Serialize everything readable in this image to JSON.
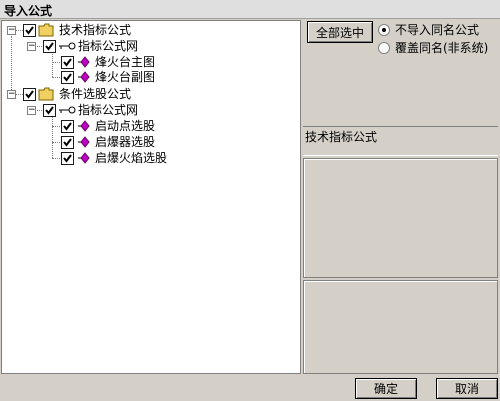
{
  "window": {
    "title": "导入公式"
  },
  "tree": {
    "groups": [
      {
        "label": "技术指标公式",
        "expanded": true,
        "checked": true,
        "icon": "folder-icon",
        "children": [
          {
            "label": "指标公式网",
            "expanded": true,
            "checked": true,
            "icon": "key-icon",
            "items": [
              {
                "label": "烽火台主图",
                "checked": true,
                "icon": "diamond-icon"
              },
              {
                "label": "烽火台副图",
                "checked": true,
                "icon": "diamond-icon"
              }
            ]
          }
        ]
      },
      {
        "label": "条件选股公式",
        "expanded": true,
        "checked": true,
        "icon": "folder-icon",
        "children": [
          {
            "label": "指标公式网",
            "expanded": true,
            "checked": true,
            "icon": "key-icon",
            "items": [
              {
                "label": "启动点选股",
                "checked": true,
                "icon": "diamond-icon"
              },
              {
                "label": "启爆器选股",
                "checked": true,
                "icon": "diamond-icon"
              },
              {
                "label": "启爆火焰选股",
                "checked": true,
                "icon": "diamond-icon"
              }
            ]
          }
        ]
      }
    ]
  },
  "options": {
    "select_all_label": "全部选中",
    "radio_no_import": "不导入同名公式",
    "radio_overwrite": "覆盖同名(非系统)",
    "selected": "no_import"
  },
  "detail": {
    "name": "技术指标公式"
  },
  "footer": {
    "ok_label": "确定",
    "cancel_label": "取消"
  },
  "colors": {
    "diamond": "#c000c0",
    "folder": "#f0d060",
    "check": "#000000"
  }
}
